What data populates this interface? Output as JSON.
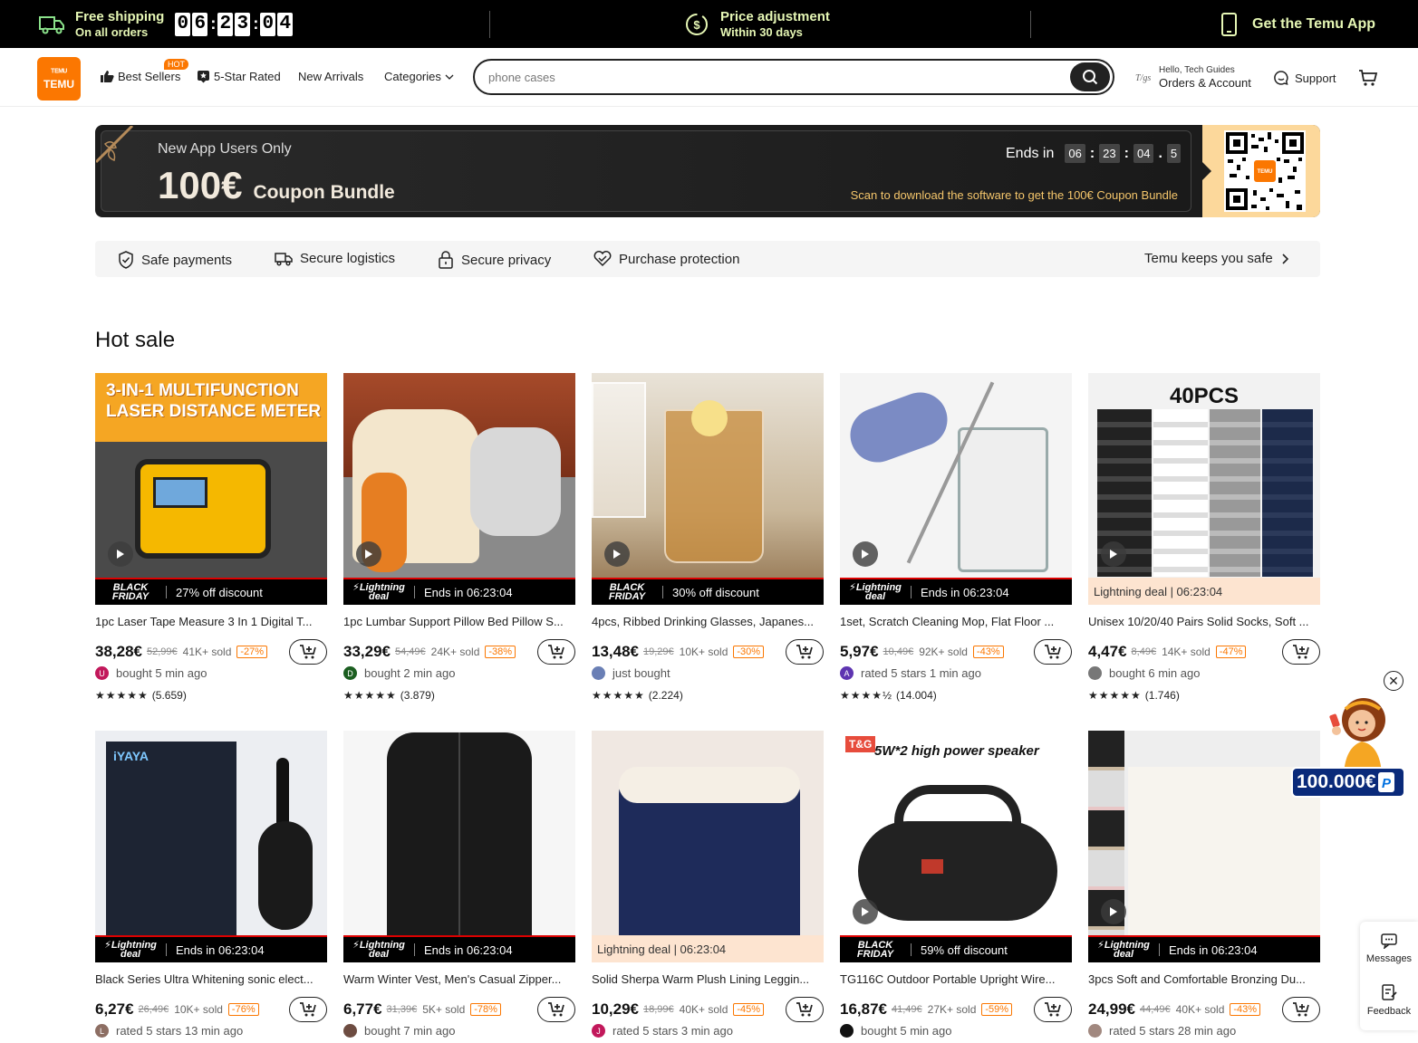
{
  "topbar": {
    "shipping_l1": "Free shipping",
    "shipping_l2": "On all orders",
    "countdown": [
      "0",
      "6",
      "2",
      "3",
      "0",
      "4"
    ],
    "price_l1": "Price adjustment",
    "price_l2": "Within 30 days",
    "app_label": "Get the Temu App"
  },
  "header": {
    "logo_l1": "TEMU",
    "logo_glyph": "ᵀᴱᴹᵁ",
    "nav": {
      "best_sellers": "Best Sellers",
      "hot_badge": "HOT",
      "five_star": "5-Star Rated",
      "new_arrivals": "New Arrivals",
      "categories": "Categories"
    },
    "search_placeholder": "phone cases",
    "account_greeting": "Hello, Tech Guides",
    "account_label": "Orders & Account",
    "support_label": "Support"
  },
  "promo": {
    "subtitle": "New App Users Only",
    "amount": "100€",
    "bundle": "Coupon Bundle",
    "ends_in": "Ends in",
    "timer": [
      "06",
      "23",
      "04",
      "5"
    ],
    "scan_text": "Scan to download the software to get the 100€ Coupon Bundle"
  },
  "trust": {
    "safe_payments": "Safe payments",
    "secure_logistics": "Secure logistics",
    "secure_privacy": "Secure privacy",
    "purchase_protection": "Purchase protection",
    "keeps_safe": "Temu keeps you safe"
  },
  "section_title": "Hot sale",
  "products": [
    {
      "title": "1pc Laser Tape Measure 3 In 1 Digital T...",
      "price": "38,28€",
      "old": "52,99€",
      "sold": "41K+ sold",
      "pct": "-27%",
      "buyer": "bought 5 min ago",
      "avatar": "U",
      "avatar_color": "#c2185b",
      "stars": "★★★★★",
      "reviews": "(5.659)",
      "deal_type": "bf",
      "deal_text": "27% off discount",
      "img": "tape"
    },
    {
      "title": "1pc Lumbar Support Pillow Bed Pillow S...",
      "price": "33,29€",
      "old": "54,49€",
      "sold": "24K+ sold",
      "pct": "-38%",
      "buyer": "bought 2 min ago",
      "avatar": "D",
      "avatar_color": "#1b5e20",
      "stars": "★★★★★",
      "reviews": "(3.879)",
      "deal_type": "lightning",
      "deal_text": "Ends in 06:23:04",
      "img": "pillow"
    },
    {
      "title": "4pcs, Ribbed Drinking Glasses, Japanes...",
      "price": "13,48€",
      "old": "19,29€",
      "sold": "10K+ sold",
      "pct": "-30%",
      "buyer": "just bought",
      "avatar": "",
      "avatar_color": "#6a7fb5",
      "stars": "★★★★★",
      "reviews": "(2.224)",
      "deal_type": "bf",
      "deal_text": "30% off discount",
      "img": "glass"
    },
    {
      "title": "1set, Scratch Cleaning Mop, Flat Floor ...",
      "price": "5,97€",
      "old": "10,49€",
      "sold": "92K+ sold",
      "pct": "-43%",
      "buyer": "rated 5 stars 1 min ago",
      "avatar": "A",
      "avatar_color": "#5e35b1",
      "stars": "★★★★½",
      "reviews": "(14.004)",
      "deal_type": "lightning",
      "deal_text": "Ends in 06:23:04",
      "img": "mop"
    },
    {
      "title": "Unisex 10/20/40 Pairs Solid Socks, Soft ...",
      "price": "4,47€",
      "old": "8,49€",
      "sold": "14K+ sold",
      "pct": "-47%",
      "buyer": "bought 6 min ago",
      "avatar": "",
      "avatar_color": "#777",
      "stars": "★★★★★",
      "reviews": "(1.746)",
      "deal_type": "light",
      "deal_text": "Lightning deal | 06:23:04",
      "img": "socks",
      "img_text": "40PCS"
    },
    {
      "title": "Black Series Ultra Whitening sonic elect...",
      "price": "6,27€",
      "old": "26,49€",
      "sold": "10K+ sold",
      "pct": "-76%",
      "buyer": "rated 5 stars 13 min ago",
      "avatar": "L",
      "avatar_color": "#8d6e63",
      "stars": "",
      "reviews": "",
      "deal_type": "lightning",
      "deal_text": "Ends in 06:23:04",
      "img": "brush",
      "img_text": "iYAYA"
    },
    {
      "title": "Warm Winter Vest, Men's Casual Zipper...",
      "price": "6,77€",
      "old": "31,39€",
      "sold": "5K+ sold",
      "pct": "-78%",
      "buyer": "bought 7 min ago",
      "avatar": "",
      "avatar_color": "#6d4c41",
      "stars": "",
      "reviews": "",
      "deal_type": "lightning",
      "deal_text": "Ends in 06:23:04",
      "img": "vest"
    },
    {
      "title": "Solid Sherpa Warm Plush Lining Leggin...",
      "price": "10,29€",
      "old": "18,99€",
      "sold": "40K+ sold",
      "pct": "-45%",
      "buyer": "rated 5 stars 3 min ago",
      "avatar": "J",
      "avatar_color": "#c2185b",
      "stars": "",
      "reviews": "",
      "deal_type": "light",
      "deal_text": "Lightning deal | 06:23:04",
      "img": "leggings"
    },
    {
      "title": "TG116C Outdoor Portable Upright Wire...",
      "price": "16,87€",
      "old": "41,49€",
      "sold": "27K+ sold",
      "pct": "-59%",
      "buyer": "bought 5 min ago",
      "avatar": "",
      "avatar_color": "#111",
      "stars": "",
      "reviews": "",
      "deal_type": "bf",
      "deal_text": "59% off discount",
      "img": "speaker",
      "img_text": "5W*2 high power speaker",
      "img_brand": "T&G"
    },
    {
      "title": "3pcs Soft and Comfortable Bronzing Du...",
      "price": "24,99€",
      "old": "44,49€",
      "sold": "40K+ sold",
      "pct": "-43%",
      "buyer": "rated 5 stars 28 min ago",
      "avatar": "",
      "avatar_color": "#a1887f",
      "stars": "",
      "reviews": "",
      "deal_type": "lightning",
      "deal_text": "Ends in 06:23:04",
      "img": "bed"
    }
  ],
  "deal_badges": {
    "bf_l1": "BLACK",
    "bf_l2": "FRIDAY",
    "lt_l1": "Lightning",
    "lt_l2": "deal"
  },
  "float": {
    "amount": "100.000€",
    "close": "✕"
  },
  "side": {
    "messages": "Messages",
    "feedback": "Feedback"
  },
  "colors": {
    "brand": "#fb7701",
    "topbar_bg": "#000000",
    "banner_bg": "#1c1c1c",
    "qr_bg": "#fcd89b"
  }
}
